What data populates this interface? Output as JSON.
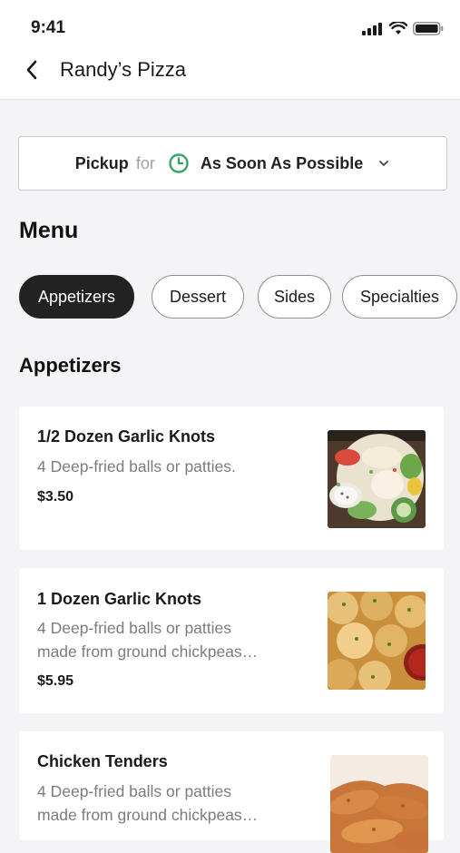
{
  "status_bar": {
    "time": "9:41"
  },
  "nav": {
    "title": "Randy’s Pizza"
  },
  "order": {
    "mode": "Pickup",
    "connector": "for",
    "when": "As Soon As Possible"
  },
  "menu": {
    "heading": "Menu",
    "categories": [
      {
        "label": "Appetizers",
        "active": true
      },
      {
        "label": "Dessert",
        "active": false
      },
      {
        "label": "Sides",
        "active": false
      },
      {
        "label": "Specialties",
        "active": false
      }
    ]
  },
  "section": {
    "title": "Appetizers",
    "items": [
      {
        "name": "1/2 Dozen Garlic Knots",
        "description": "4 Deep-fried balls or patties.",
        "price": "$3.50",
        "image": "salad-photo"
      },
      {
        "name": "1 Dozen Garlic Knots",
        "description_line1": "4 Deep-fried balls or patties",
        "description_line2": "made from ground chickpeas…",
        "price": "$5.95",
        "image": "garlic-knots-photo"
      },
      {
        "name": "Chicken Tenders",
        "description_line1": "4 Deep-fried balls or patties",
        "description_line2": "made from ground chickpeas…",
        "image": "chicken-tenders-photo"
      }
    ]
  },
  "colors": {
    "clock_icon": "#3aa56b",
    "active_chip": "#222222",
    "background": "#f4f4f6"
  }
}
